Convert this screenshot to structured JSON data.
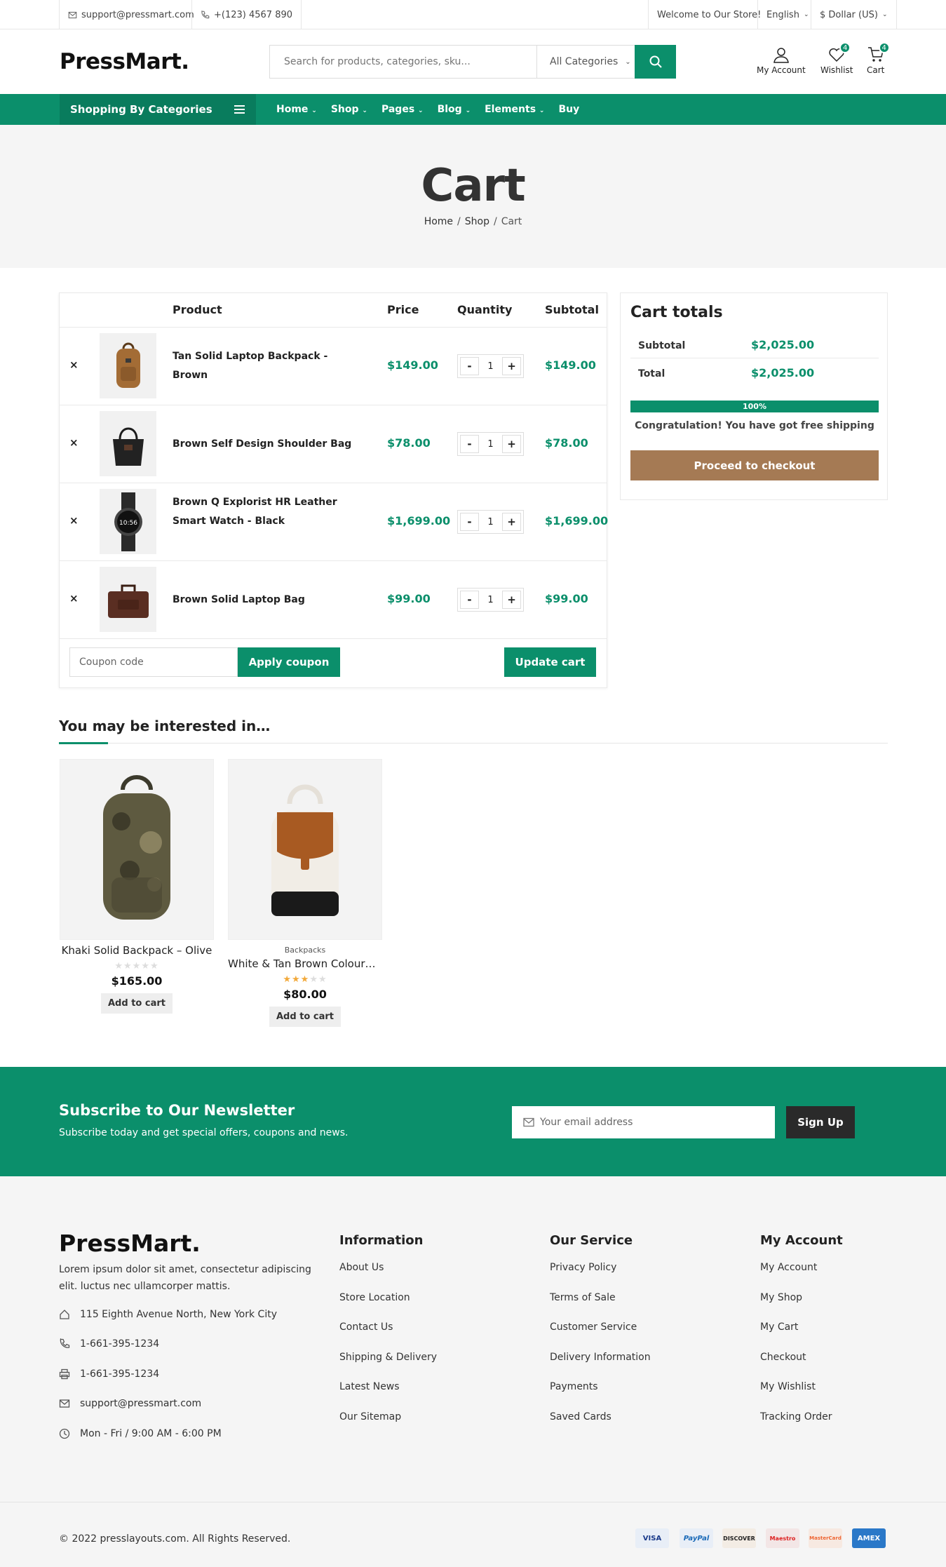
{
  "topbar": {
    "email": "support@pressmart.com",
    "phone": "+(123) 4567 890",
    "welcome": "Welcome to Our Store!",
    "language": "English",
    "currency": "$ Dollar (US)"
  },
  "header": {
    "logo": "PressMart.",
    "search_placeholder": "Search for products, categories, sku...",
    "category_select": "All Categories",
    "account_label": "My Account",
    "wishlist_label": "Wishlist",
    "wishlist_count": "4",
    "cart_label": "Cart",
    "cart_count": "4"
  },
  "nav": {
    "categories_label": "Shopping By Categories",
    "items": [
      "Home",
      "Shop",
      "Pages",
      "Blog",
      "Elements",
      "Buy"
    ]
  },
  "page": {
    "title": "Cart",
    "breadcrumb": [
      "Home",
      "Shop",
      "Cart"
    ]
  },
  "cart": {
    "headers": {
      "product": "Product",
      "price": "Price",
      "quantity": "Quantity",
      "subtotal": "Subtotal"
    },
    "items": [
      {
        "name": "Tan Solid Laptop Backpack - Brown",
        "price": "$149.00",
        "qty": "1",
        "subtotal": "$149.00"
      },
      {
        "name": "Brown Self Design Shoulder Bag",
        "price": "$78.00",
        "qty": "1",
        "subtotal": "$78.00"
      },
      {
        "name": "Brown Q Explorist HR Leather Smart Watch - Black",
        "price": "$1,699.00",
        "qty": "1",
        "subtotal": "$1,699.00"
      },
      {
        "name": "Brown Solid Laptop Bag",
        "price": "$99.00",
        "qty": "1",
        "subtotal": "$99.00"
      }
    ],
    "coupon_placeholder": "Coupon code",
    "apply_coupon": "Apply coupon",
    "update_cart": "Update cart",
    "remove_symbol": "×",
    "minus": "-",
    "plus": "+",
    "watch_time": "10:56"
  },
  "totals": {
    "title": "Cart totals",
    "subtotal_label": "Subtotal",
    "subtotal": "$2,025.00",
    "total_label": "Total",
    "total": "$2,025.00",
    "shipping_progress": "100%",
    "message": "Congratulation! You have got free shipping",
    "checkout": "Proceed to checkout"
  },
  "interested": {
    "title": "You may be interested in…",
    "products": [
      {
        "category": "",
        "name": "Khaki Solid Backpack – Olive",
        "rating": 0,
        "price": "$165.00",
        "button": "Add to cart"
      },
      {
        "category": "Backpacks",
        "name": "White & Tan Brown Colourblocked Backpack",
        "rating": 3,
        "price": "$80.00",
        "button": "Add to cart"
      }
    ]
  },
  "newsletter": {
    "title": "Subscribe to Our Newsletter",
    "subtitle": "Subscribe today and get special offers, coupons and news.",
    "placeholder": "Your email address",
    "button": "Sign Up"
  },
  "footer": {
    "logo": "PressMart.",
    "description": "Lorem ipsum dolor sit amet, consectetur adipiscing elit. luctus nec ullamcorper mattis.",
    "address": "115 Eighth Avenue North, New York City",
    "phone": "1-661-395-1234",
    "fax": "1-661-395-1234",
    "email": "support@pressmart.com",
    "hours": "Mon - Fri / 9:00 AM - 6:00 PM",
    "columns": [
      {
        "title": "Information",
        "links": [
          "About Us",
          "Store Location",
          "Contact Us",
          "Shipping & Delivery",
          "Latest News",
          "Our Sitemap"
        ]
      },
      {
        "title": "Our Service",
        "links": [
          "Privacy Policy",
          "Terms of Sale",
          "Customer Service",
          "Delivery Information",
          "Payments",
          "Saved Cards"
        ]
      },
      {
        "title": "My Account",
        "links": [
          "My Account",
          "My Shop",
          "My Cart",
          "Checkout",
          "My Wishlist",
          "Tracking Order"
        ]
      }
    ],
    "copyright": "© 2022 presslayouts.com. All Rights Reserved.",
    "payments": [
      "VISA",
      "PayPal",
      "DISCOVER",
      "Maestro",
      "MasterCard",
      "AMEX"
    ]
  },
  "colors": {
    "accent": "#0b8f6b",
    "checkout": "#a57a54",
    "star": "#f2a93b"
  }
}
